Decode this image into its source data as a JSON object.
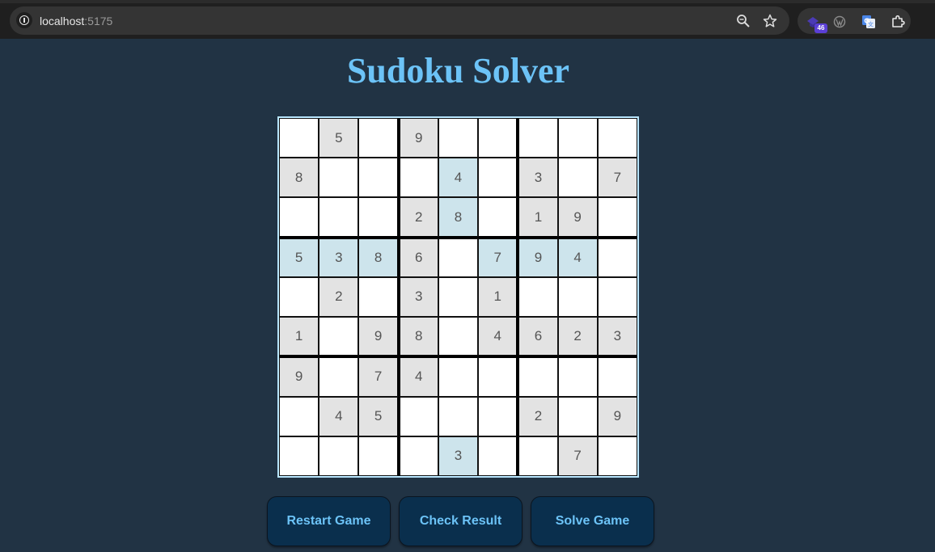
{
  "browser": {
    "url_host": "localhost",
    "url_port": ":5175",
    "extensions_badge": "46"
  },
  "page": {
    "title": "Sudoku Solver"
  },
  "board": {
    "rows": [
      [
        "",
        "5",
        "",
        "9",
        "",
        "",
        "",
        "",
        ""
      ],
      [
        "8",
        "",
        "",
        "",
        "4",
        "",
        "3",
        "",
        "7"
      ],
      [
        "",
        "",
        "",
        "2",
        "8",
        "",
        "1",
        "9",
        ""
      ],
      [
        "5",
        "3",
        "8",
        "6",
        "",
        "7",
        "9",
        "4",
        ""
      ],
      [
        "",
        "2",
        "",
        "3",
        "",
        "1",
        "",
        "",
        ""
      ],
      [
        "1",
        "",
        "9",
        "8",
        "",
        "4",
        "6",
        "2",
        "3"
      ],
      [
        "9",
        "",
        "7",
        "4",
        "",
        "",
        "",
        "",
        ""
      ],
      [
        "",
        "4",
        "5",
        "",
        "",
        "",
        "2",
        "",
        "9"
      ],
      [
        "",
        "",
        "",
        "",
        "3",
        "",
        "",
        "7",
        ""
      ]
    ],
    "cell_state": [
      [
        "empty",
        "given",
        "empty",
        "given",
        "empty",
        "empty",
        "empty",
        "empty",
        "empty"
      ],
      [
        "given",
        "empty",
        "empty",
        "empty",
        "highlight",
        "empty",
        "given",
        "empty",
        "given"
      ],
      [
        "empty",
        "empty",
        "empty",
        "given",
        "highlight",
        "empty",
        "given",
        "given",
        "empty"
      ],
      [
        "highlight",
        "highlight",
        "highlight",
        "given",
        "empty",
        "highlight",
        "highlight",
        "highlight",
        "empty"
      ],
      [
        "empty",
        "given",
        "empty",
        "given",
        "empty",
        "given",
        "empty",
        "empty",
        "empty"
      ],
      [
        "given",
        "empty",
        "given",
        "given",
        "empty",
        "given",
        "given",
        "given",
        "given"
      ],
      [
        "given",
        "empty",
        "given",
        "given",
        "empty",
        "empty",
        "empty",
        "empty",
        "empty"
      ],
      [
        "empty",
        "given",
        "given",
        "empty",
        "empty",
        "empty",
        "given",
        "empty",
        "given"
      ],
      [
        "empty",
        "empty",
        "empty",
        "empty",
        "highlight",
        "empty",
        "empty",
        "given",
        "empty"
      ]
    ]
  },
  "buttons": {
    "restart_label": "Restart Game",
    "check_label": "Check Result",
    "solve_label": "Solve Game"
  },
  "colors": {
    "page_background": "#213344",
    "accent": "#6cc3f7",
    "button_background": "#0a2f4d",
    "given_cell": "#e3e3e3",
    "highlight_cell": "#cde4ec",
    "empty_cell": "#ffffff"
  },
  "icons": {
    "site_info": "info-icon",
    "zoom": "zoom-icon",
    "bookmark": "star-icon",
    "extension_1": "extension-badge-icon",
    "extension_2": "wordpress-icon",
    "extension_3": "translate-icon",
    "extensions_menu": "puzzle-icon"
  }
}
